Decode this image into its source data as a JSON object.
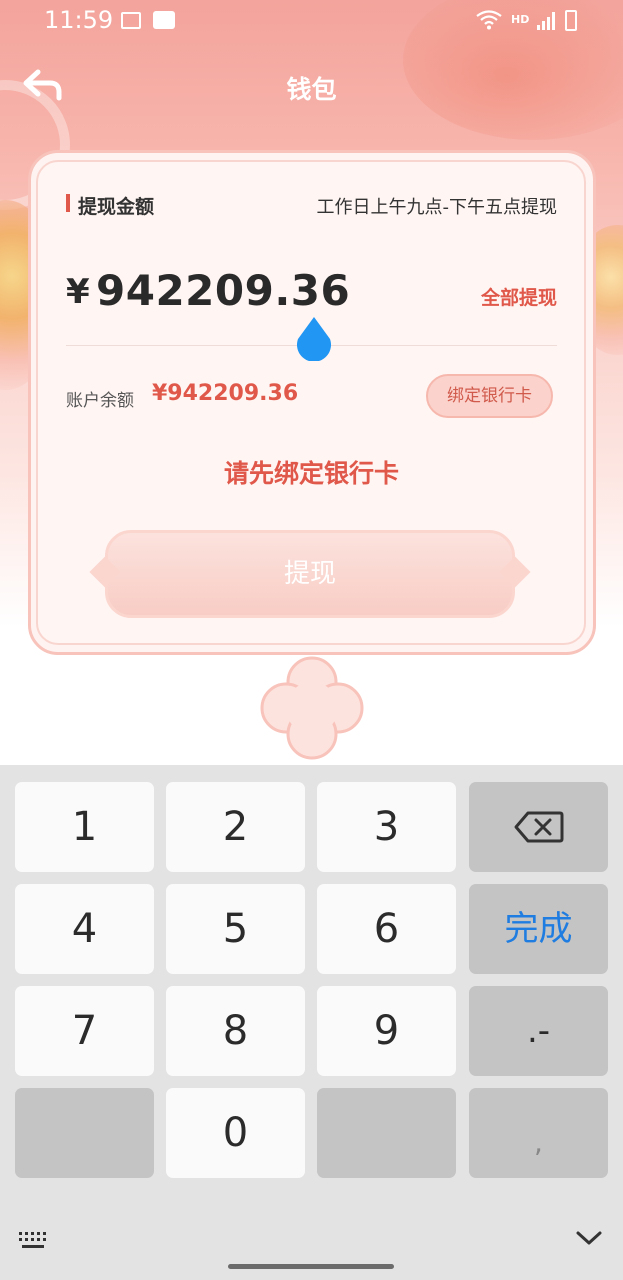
{
  "status_bar": {
    "time": "11:59",
    "network": "HD"
  },
  "header": {
    "title": "钱包",
    "back_icon": "back-arrow-icon"
  },
  "withdraw_card": {
    "amount_label": "提现金额",
    "hours_note": "工作日上午九点-下午五点提现",
    "currency_sign": "¥",
    "amount_value": "942209.36",
    "withdraw_all_label": "全部提现",
    "balance_label": "账户余额",
    "balance_value": "¥942209.36",
    "bind_card_label": "绑定银行卡",
    "bind_warning": "请先绑定银行卡",
    "withdraw_button_label": "提现"
  },
  "keyboard": {
    "keys": {
      "k1": "1",
      "k2": "2",
      "k3": "3",
      "k4": "4",
      "k5": "5",
      "k6": "6",
      "k7": "7",
      "k8": "8",
      "k9": "9",
      "k0": "0",
      "done": "完成",
      "dot": ".-",
      "comma": ","
    },
    "backspace_icon": "backspace-icon",
    "switch_icon": "keyboard-switch-icon",
    "hide_icon": "chevron-down-icon"
  },
  "colors": {
    "accent": "#e0584a",
    "header_gradient_top": "#f3a49c",
    "done_blue": "#1f7ce0",
    "cursor_blue": "#2196f3"
  }
}
